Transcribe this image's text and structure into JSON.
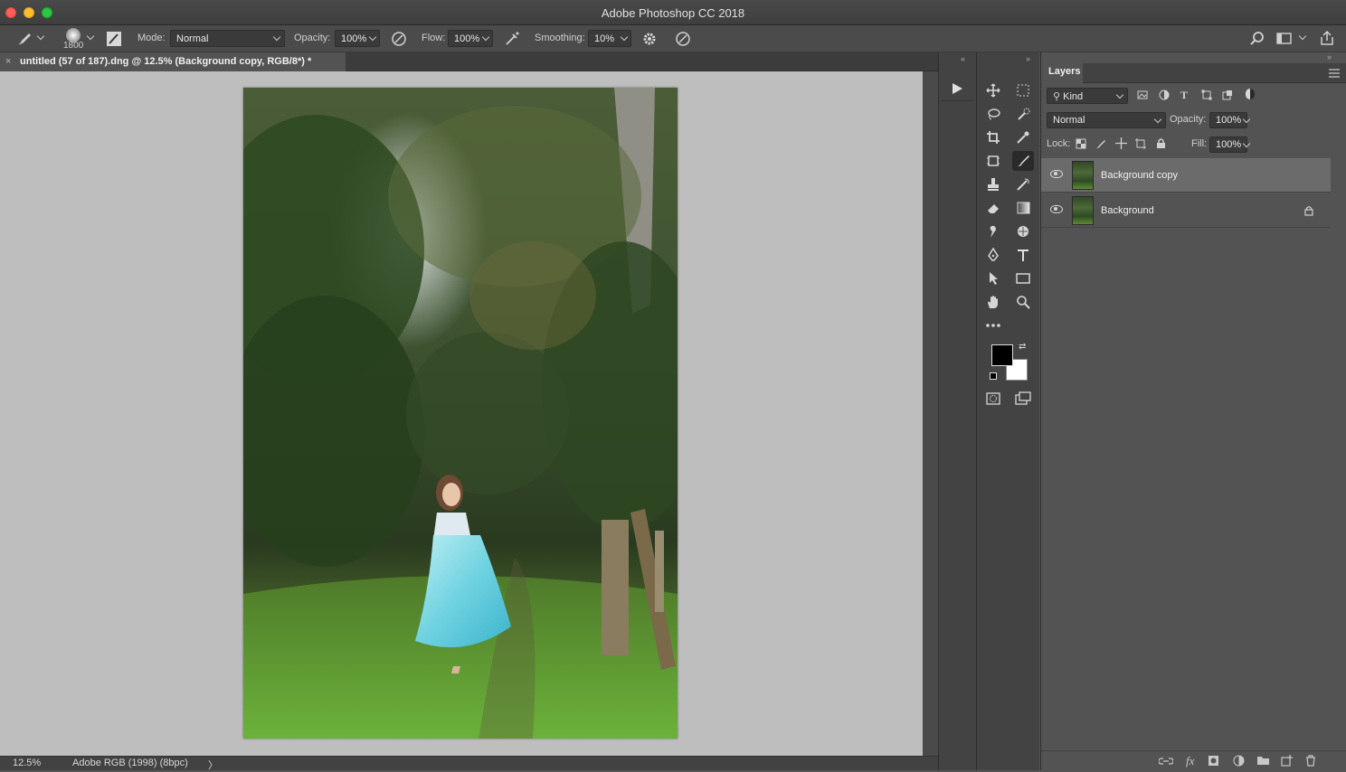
{
  "window": {
    "title": "Adobe Photoshop CC 2018"
  },
  "options_bar": {
    "brush_size": "1800",
    "mode_label": "Mode:",
    "mode_value": "Normal",
    "opacity_label": "Opacity:",
    "opacity_value": "100%",
    "flow_label": "Flow:",
    "flow_value": "100%",
    "smoothing_label": "Smoothing:",
    "smoothing_value": "10%"
  },
  "document": {
    "tab_title": "untitled (57 of 187).dng @ 12.5% (Background copy, RGB/8*) *",
    "close_glyph": "×"
  },
  "status_bar": {
    "zoom": "12.5%",
    "profile": "Adobe RGB (1998) (8bpc)",
    "arrow": "〉"
  },
  "layers_panel": {
    "tab_label": "Layers",
    "filter_kind": "Kind",
    "blend_mode": "Normal",
    "opacity_label": "Opacity:",
    "opacity_value": "100%",
    "lock_label": "Lock:",
    "fill_label": "Fill:",
    "fill_value": "100%",
    "layers": [
      {
        "name": "Background copy",
        "selected": true,
        "locked": false
      },
      {
        "name": "Background",
        "selected": false,
        "locked": true
      }
    ]
  },
  "tools": [
    "move-tool-icon",
    "marquee-tool-icon",
    "lasso-tool-icon",
    "quick-select-tool-icon",
    "crop-tool-icon",
    "eyedropper-tool-icon",
    "frame-tool-icon",
    "brush-tool-icon",
    "stamp-tool-icon",
    "history-brush-tool-icon",
    "eraser-tool-icon",
    "gradient-tool-icon",
    "smudge-tool-icon",
    "dodge-tool-icon",
    "pen-tool-icon",
    "type-tool-icon",
    "path-select-tool-icon",
    "rectangle-tool-icon",
    "hand-tool-icon",
    "zoom-tool-icon"
  ],
  "colors": {
    "foreground": "#000000",
    "background": "#ffffff",
    "canvas_bg": "#bebebe",
    "panel_bg": "#535353"
  }
}
